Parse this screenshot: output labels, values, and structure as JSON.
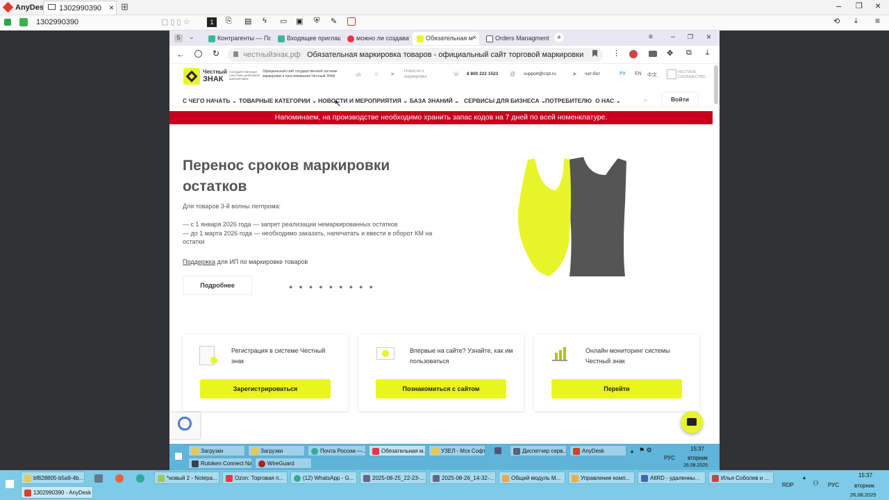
{
  "anydesk": {
    "app_name": "AnyDesk",
    "session_tab": "1302990390",
    "address": "1302990390"
  },
  "browser": {
    "tabs": [
      "Контрагенты — По",
      "Входящее приглаш",
      "можно ли создават",
      "Обязательная м",
      "Orders Managment"
    ],
    "tab_counter": "5",
    "url_domain": "честныйзнак.рф",
    "page_title": "Обязательная маркировка товаров - официальный сайт торговой маркировки Ч..."
  },
  "site": {
    "logo_line1": "Честный",
    "logo_line2": "ЗНАК",
    "logo_sub": "ГОСУДАРСТВЕННАЯ СИСТЕМА ЦИФРОВОЙ МАРКИРОВКИ",
    "official": "Официальный сайт государственной системы маркировки и прослеживания Честный ЗНАК",
    "news_label": "Новости о маркировке",
    "phone": "8 800 222 1523",
    "email": "support@crpt.ru",
    "chat": "чат-бот",
    "langs": [
      "РУ",
      "EN",
      "中文"
    ],
    "partner": "ЧЕСТНОЕ СООБЩЕСТВО",
    "nav": [
      "С ЧЕГО НАЧАТЬ",
      "ТОВАРНЫЕ КАТЕГОРИИ",
      "НОВОСТИ И МЕРОПРИЯТИЯ",
      "БАЗА ЗНАНИЙ",
      "СЕРВИСЫ ДЛЯ БИЗНЕСА",
      "ПОТРЕБИТЕЛЮ",
      "О НАС"
    ],
    "login": "Войти",
    "banner": "Напоминаем, на производстве необходимо хранить запас кодов на 7 дней по всей номенклатуре.",
    "hero_title": "Перенос сроков маркировки остатков",
    "hero_intro": "Для товаров 3-й волны легпрома:",
    "hero_line1": "— с 1 января 2026 года — запрет реализации немаркированных остатков",
    "hero_line2": "— до 1 марта 2026 года — необходимо заказать, напечатать и ввести в оборот КМ на остатки",
    "support_link": "Поддержка",
    "support_rest": " для ИП по маркировке товаров",
    "more_btn": "Подробнее",
    "cards": [
      {
        "title": "Регистрация в системе Честный знак",
        "btn": "Зарегистрироваться"
      },
      {
        "title": "Впервые на сайте? Узнайте, как им пользоваться",
        "btn": "Познакомиться с сайтом"
      },
      {
        "title": "Онлайн мониторинг системы Честный знак",
        "btn": "Перейти"
      }
    ]
  },
  "inner_taskbar": {
    "items": [
      "Загрузки",
      "Загрузки",
      "Почта России —...",
      "Обязательная м...",
      "УЗЕЛ - Мск Софт",
      "Диспетчер серв...",
      "AnyDesk",
      "Rutoken Connect Na...",
      "WireGuard"
    ],
    "lang": "РУС",
    "time": "15:37",
    "day": "вторник",
    "date": "26.08.2025"
  },
  "outer_taskbar": {
    "items": [
      "bf828805-b5a9-4b...",
      "*новый 2 - Notepa...",
      "Ozon: Торговая п...",
      "(12) WhatsApp - G...",
      "2025-08-25_22-23-...",
      "2025-08-26_14-32-...",
      "Общий модуль М...",
      "Управление комп...",
      "AltRD - удаленны...",
      "Илья Соболев и ...",
      "1302990390 - AnyDesk"
    ],
    "rdp": "RDP",
    "lang": "РУС",
    "time": "15:37",
    "day": "вторник",
    "date": "26.08.2025"
  },
  "colors": {
    "accent": "#e8f52a",
    "banner": "#c8001e",
    "taskbar": "#7dcbe6"
  }
}
